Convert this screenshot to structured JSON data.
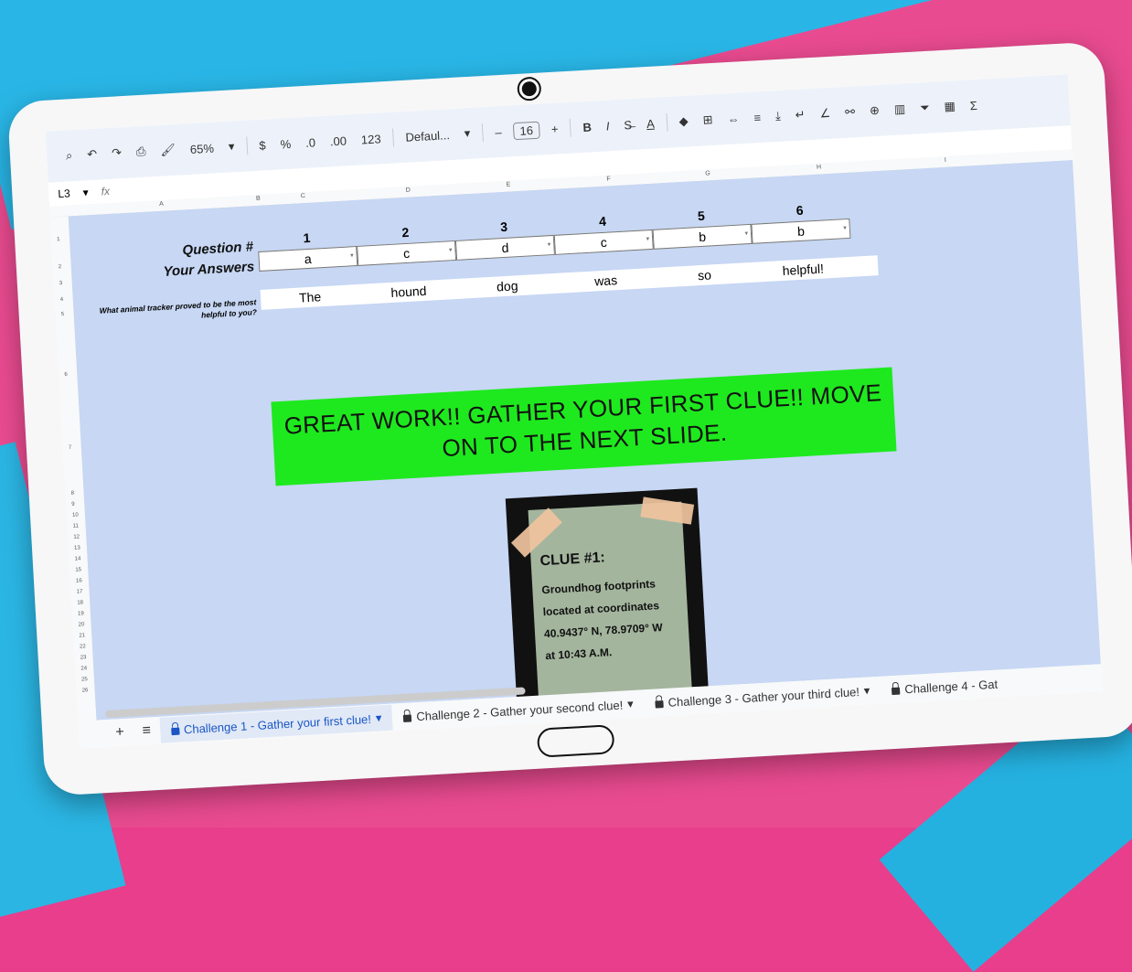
{
  "toolbar": {
    "zoom": "65%",
    "currency": "$",
    "percent": "%",
    "dec_decrease": ".0",
    "dec_increase": ".00",
    "number_format": "123",
    "font": "Defaul...",
    "minus": "–",
    "font_size": "16",
    "plus": "+",
    "bold": "B",
    "italic": "I",
    "text_color": "A",
    "sum": "Σ"
  },
  "formula_bar": {
    "cell_ref": "L3",
    "fx": "fx"
  },
  "columns": [
    "A",
    "B",
    "C",
    "D",
    "E",
    "F",
    "G",
    "H",
    "I"
  ],
  "rows": [
    "1",
    "2",
    "3",
    "4",
    "5",
    "6",
    "7",
    "8",
    "9",
    "10",
    "11",
    "12",
    "13",
    "14",
    "15",
    "16",
    "17",
    "18",
    "19",
    "20",
    "21",
    "22",
    "23",
    "24",
    "25",
    "26"
  ],
  "quiz": {
    "question_label": "Question #",
    "answers_label": "Your Answers",
    "numbers": [
      "1",
      "2",
      "3",
      "4",
      "5",
      "6"
    ],
    "answers": [
      "a",
      "c",
      "d",
      "c",
      "b",
      "b"
    ],
    "question_text": "What animal tracker proved to be the most helpful to you?",
    "words": [
      "The",
      "hound",
      "dog",
      "was",
      "so",
      "helpful!"
    ]
  },
  "banner": {
    "text": "GREAT WORK!! GATHER YOUR FIRST CLUE!! MOVE ON TO THE NEXT SLIDE.",
    "color": "#1ee91e"
  },
  "clue": {
    "title": "CLUE #1:",
    "line1": "Groundhog footprints",
    "line2": "located at coordinates",
    "line3": "40.9437° N, 78.9709° W",
    "line4": "at 10:43 A.M."
  },
  "tabs": {
    "add": "+",
    "list": "≡",
    "items": [
      "Challenge 1 - Gather your first clue!",
      "Challenge 2 - Gather your second clue!",
      "Challenge 3 - Gather your third clue!",
      "Challenge 4 - Gat"
    ]
  },
  "colors": {
    "sheet_bg": "#c7d7f4",
    "active_tab": "#1a56c4"
  }
}
